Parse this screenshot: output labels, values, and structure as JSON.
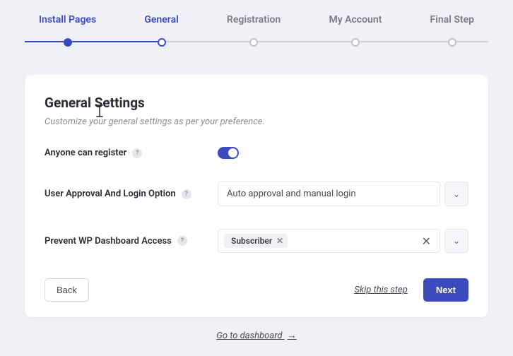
{
  "steps": [
    {
      "label": "Install Pages"
    },
    {
      "label": "General"
    },
    {
      "label": "Registration"
    },
    {
      "label": "My Account"
    },
    {
      "label": "Final Step"
    }
  ],
  "page": {
    "title": "General Settings",
    "subtitle": "Customize your general settings as per your preference."
  },
  "settings": {
    "anyone_label": "Anyone can register",
    "approval_label": "User Approval And Login Option",
    "approval_value": "Auto approval and manual login",
    "prevent_label": "Prevent WP Dashboard Access",
    "prevent_tag": "Subscriber"
  },
  "footer": {
    "back": "Back",
    "skip": "Skip this step",
    "next": "Next",
    "dashboard": "Go to dashboard"
  }
}
